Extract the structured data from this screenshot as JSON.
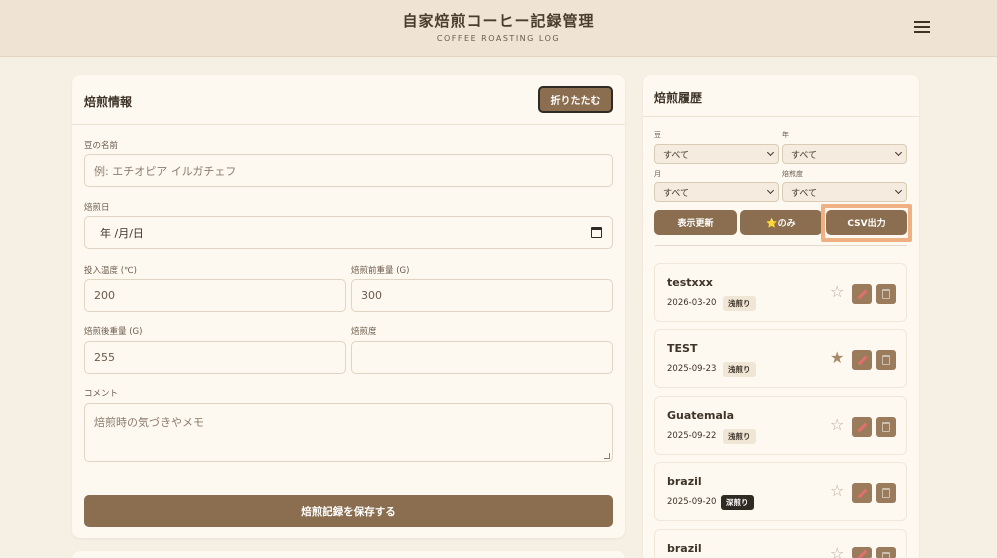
{
  "header": {
    "title": "自家焙煎コーヒー記録管理",
    "subtitle": "COFFEE ROASTING LOG"
  },
  "form": {
    "title": "焙煎情報",
    "collapse_label": "折りたたむ",
    "bean_name_label": "豆の名前",
    "bean_name_placeholder": "例: エチオピア イルガチェフ",
    "roast_date_label": "焙煎日",
    "roast_date_value": "年 /月/日",
    "temp_label": "投入温度 (℃)",
    "temp_value": "200",
    "pre_weight_label": "焙煎前重量 (G)",
    "pre_weight_value": "300",
    "post_weight_label": "焙煎後重量 (G)",
    "post_weight_value": "255",
    "roast_level_label": "焙煎度",
    "roast_level_value": "",
    "comment_label": "コメント",
    "comment_placeholder": "焙煎時の気づきやメモ",
    "save_label": "焙煎記録を保存する"
  },
  "history": {
    "title": "焙煎履歴",
    "filters": {
      "bean_label": "豆",
      "bean_value": "すべて",
      "year_label": "年",
      "year_value": "すべて",
      "month_label": "月",
      "month_value": "すべて",
      "level_label": "焙煎度",
      "level_value": "すべて"
    },
    "refresh_label": "表示更新",
    "favorites_label": "⭐のみ",
    "csv_label": "CSV出力",
    "entries": [
      {
        "name": "testxxx",
        "date": "2026-03-20",
        "level": "浅煎り",
        "favorite": false,
        "level_style": "light"
      },
      {
        "name": "TEST",
        "date": "2025-09-23",
        "level": "浅煎り",
        "favorite": true,
        "level_style": "light"
      },
      {
        "name": "Guatemala",
        "date": "2025-09-22",
        "level": "浅煎り",
        "favorite": false,
        "level_style": "light"
      },
      {
        "name": "brazil",
        "date": "2025-09-20",
        "level": "深煎り",
        "favorite": false,
        "level_style": "dark"
      },
      {
        "name": "brazil",
        "date": "",
        "level": "",
        "favorite": false,
        "level_style": "light"
      }
    ]
  },
  "colors": {
    "background": "#f6efe3",
    "accent": "#8a6e4f",
    "highlight": "#efb184"
  }
}
